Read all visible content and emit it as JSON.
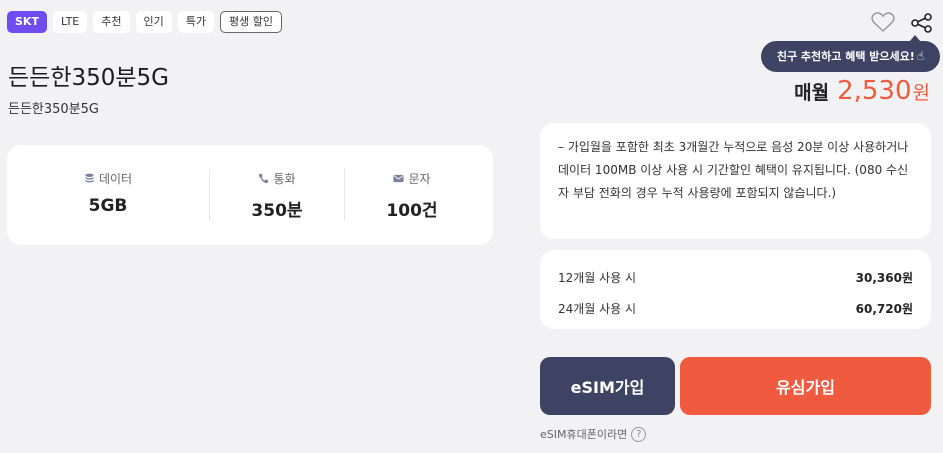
{
  "tags": [
    "SKT",
    "LTE",
    "추천",
    "인기",
    "특가",
    "평생 할인"
  ],
  "plan": {
    "title": "든든한350분5G",
    "subtitle": "든든한350분5G"
  },
  "specs": [
    {
      "label": "데이터",
      "value": "5GB",
      "icon": "database-icon"
    },
    {
      "label": "통화",
      "value": "350분",
      "icon": "phone-icon"
    },
    {
      "label": "문자",
      "value": "100건",
      "icon": "mail-icon"
    }
  ],
  "tooltip": {
    "text": "친구 추천하고 혜택 받으세요!"
  },
  "price": {
    "label": "매월",
    "amount": "2,530",
    "unit": "원"
  },
  "notice": {
    "text": "– 가입월을 포함한 최초 3개월간 누적으로 음성 20분 이상 사용하거나 데이터 100MB 이상 사용 시 기간할인 혜택이 유지됩니다. (080 수신자 부담 전화의 경우 누적 사용량에 포함되지 않습니다.)"
  },
  "costs": [
    {
      "label": "12개월 사용 시",
      "amount": "30,360원"
    },
    {
      "label": "24개월 사용 시",
      "amount": "60,720원"
    }
  ],
  "buttons": {
    "esim": "eSIM가입",
    "usim": "유심가입"
  },
  "esim_help": {
    "text": "eSIM휴대폰이라면",
    "icon_glyph": "?"
  },
  "colors": {
    "carrier": "#6f4bf2",
    "accent": "#f05a3e",
    "navy": "#3e4364"
  }
}
